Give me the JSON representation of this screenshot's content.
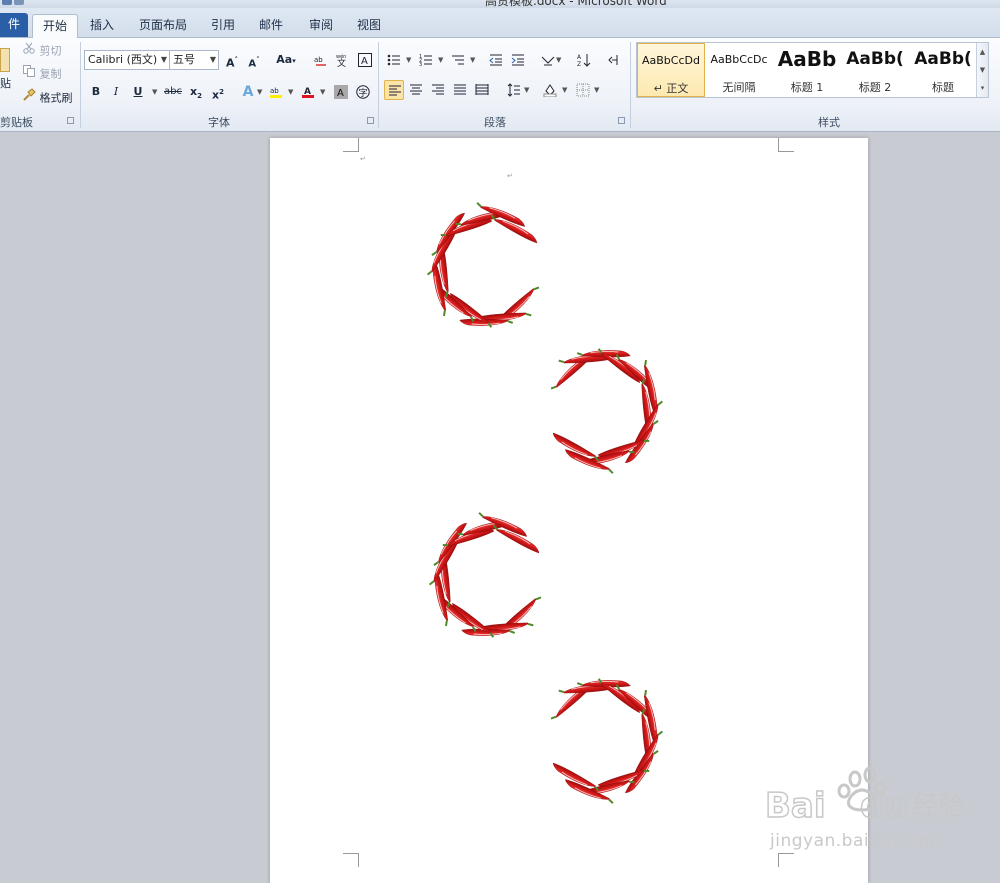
{
  "window": {
    "title": "高贵模板.docx - Microsoft Word"
  },
  "tabs": [
    {
      "label": "件",
      "kind": "file"
    },
    {
      "label": "开始",
      "kind": "active"
    },
    {
      "label": "插入"
    },
    {
      "label": "页面布局"
    },
    {
      "label": "引用"
    },
    {
      "label": "邮件"
    },
    {
      "label": "审阅"
    },
    {
      "label": "视图"
    }
  ],
  "clipboard": {
    "paste": "贴",
    "cut": "剪切",
    "copy": "复制",
    "format_painter": "格式刷",
    "group_label": "剪贴板"
  },
  "font": {
    "name": "Calibri (西文)",
    "size": "五号",
    "group_label": "字体"
  },
  "paragraph": {
    "group_label": "段落"
  },
  "styles": {
    "group_label": "样式",
    "items": [
      {
        "sample": "AaBbCcDd",
        "name": "↵ 正文",
        "selected": true
      },
      {
        "sample": "AaBbCcDc",
        "name": "无间隔"
      },
      {
        "sample": "AaBb",
        "name": "标题 1"
      },
      {
        "sample": "AaBb(",
        "name": "标题 2"
      },
      {
        "sample": "AaBb(",
        "name": "标题"
      }
    ]
  },
  "document": {
    "page_marks": [
      "↵",
      "↵"
    ],
    "chili_wreaths": [
      {
        "opening": "right"
      },
      {
        "opening": "left"
      },
      {
        "opening": "right"
      },
      {
        "opening": "left"
      }
    ]
  },
  "watermark": {
    "brand": "Baidu 经验",
    "url": "jingyan.baidu.com"
  },
  "colors": {
    "accent_file_tab": "#2a5fa8",
    "highlight": "#fbe4a8",
    "font_color_red": "#e0141e",
    "chili_red": "#d41a1a",
    "stem_green": "#4f8a2a"
  }
}
